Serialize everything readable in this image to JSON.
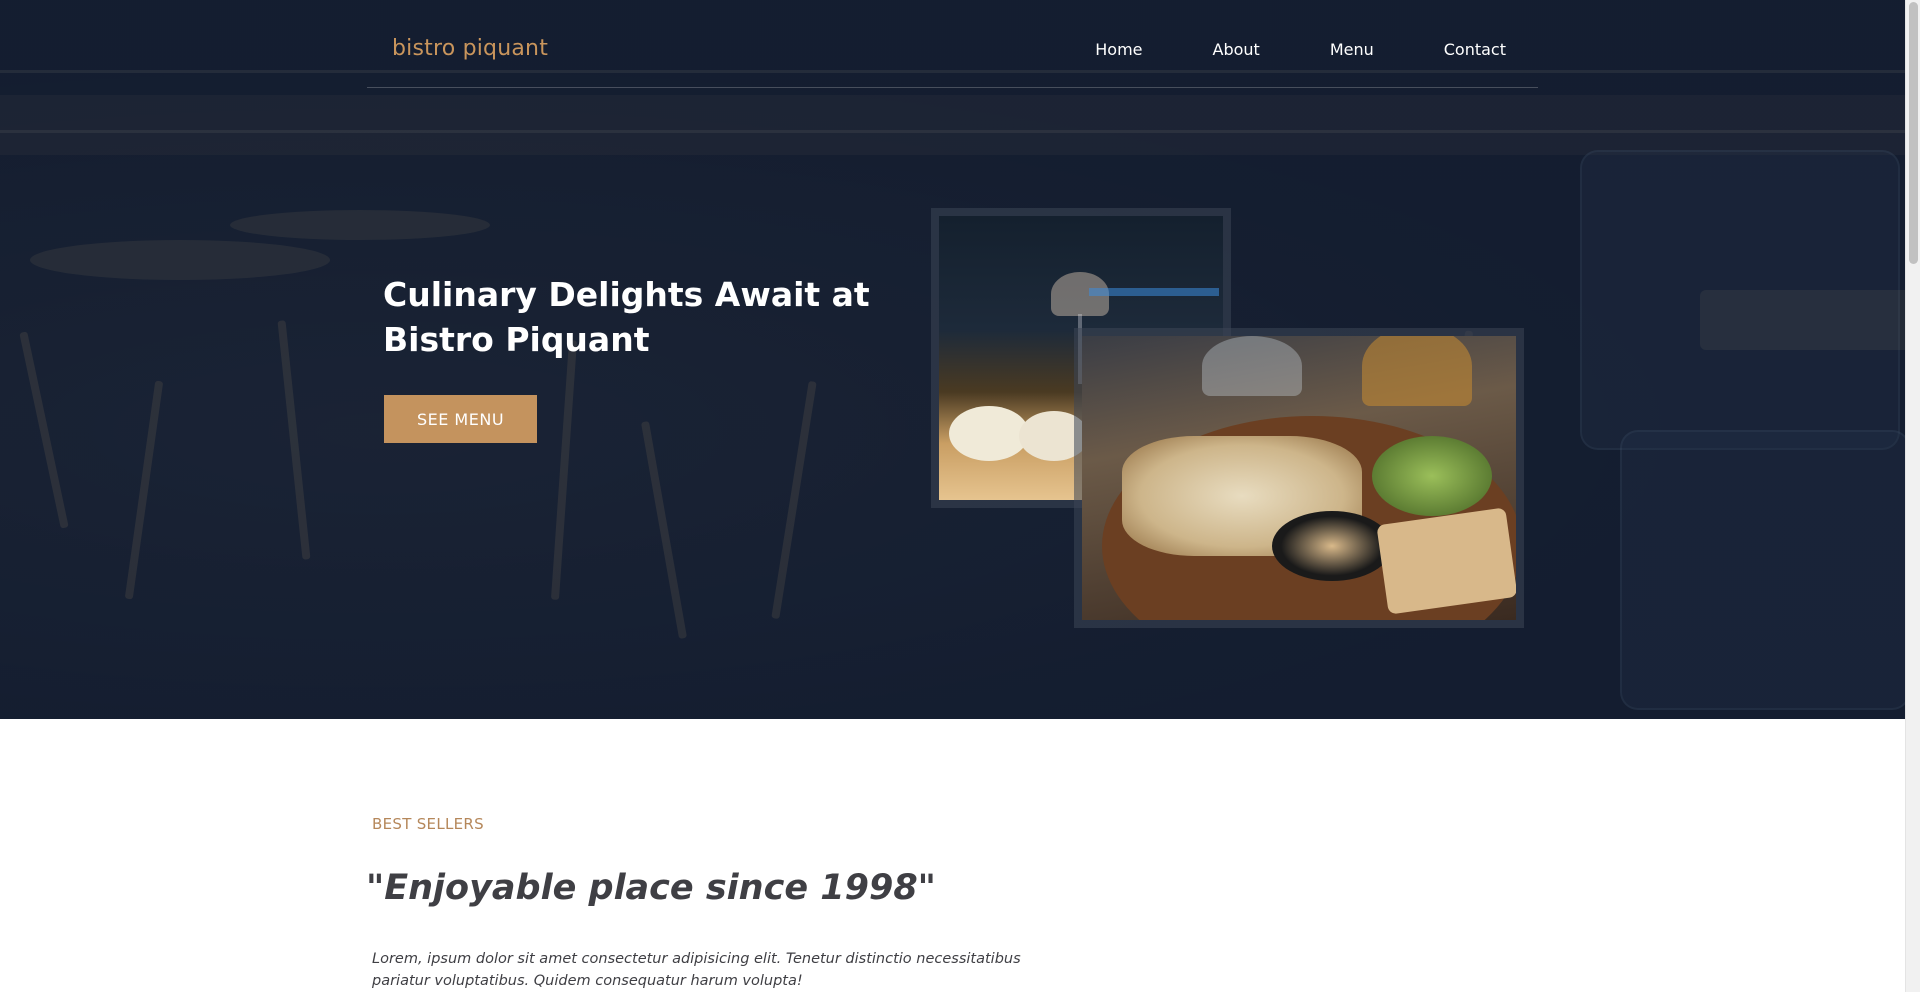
{
  "header": {
    "logo": "bistro piquant",
    "nav": [
      "Home",
      "About",
      "Menu",
      "Contact"
    ]
  },
  "hero": {
    "title": "Culinary Delights Await at Bistro Piquant",
    "button": "SEE MENU"
  },
  "about": {
    "eyebrow": "BEST SELLERS",
    "quote": "\"Enjoyable place since 1998\"",
    "text": "Lorem, ipsum dolor sit amet consectetur adipisicing elit. Tenetur distinctio necessitatibus pariatur voluptatibus. Quidem consequatur harum volupta!"
  },
  "colors": {
    "accent": "#c4935e",
    "hero_overlay": "#1b2230",
    "text_dark": "#3f3f44"
  }
}
